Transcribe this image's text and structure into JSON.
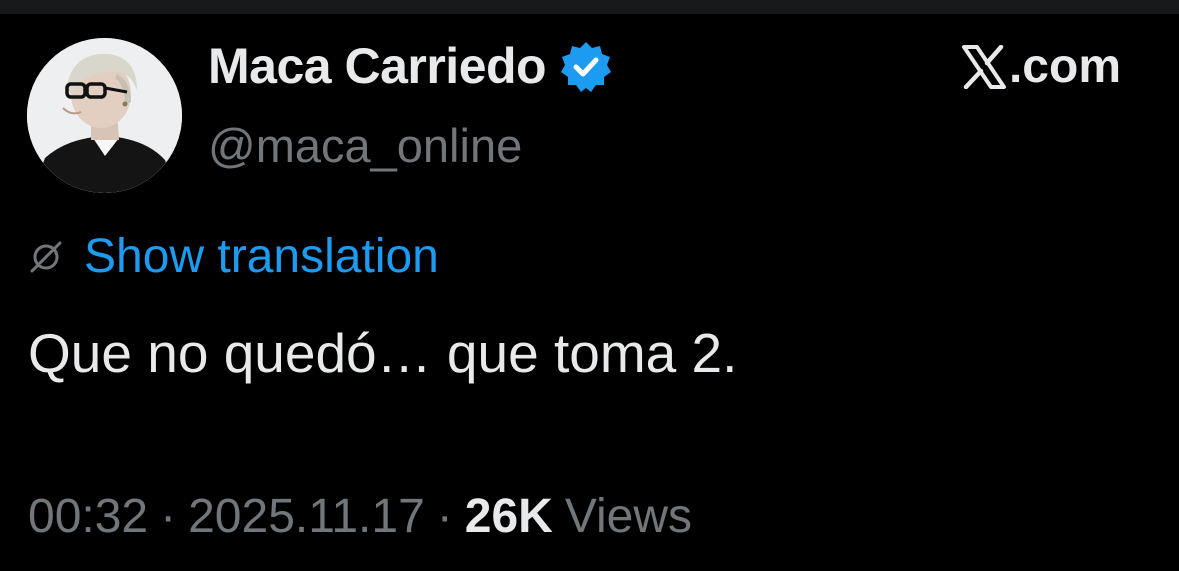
{
  "author": {
    "display_name": "Maca Carriedo",
    "handle": "@maca_online",
    "verified": true,
    "avatar_icon": "profile-photo",
    "verified_color": "#1d9bf0"
  },
  "brand": {
    "logo_icon": "x-logo",
    "domain_text": ".com"
  },
  "translation": {
    "icon": "globe-icon",
    "label": "Show translation",
    "color": "#1d9bf0"
  },
  "tweet": {
    "text": "Que no quedó… que toma 2."
  },
  "meta": {
    "time": "00:32",
    "separator": "·",
    "date": "2025.11.17",
    "views_count": "26K",
    "views_label": "Views"
  },
  "theme": {
    "background": "#000000",
    "primary_text": "#e7e9ea",
    "secondary_text": "#71767b"
  }
}
